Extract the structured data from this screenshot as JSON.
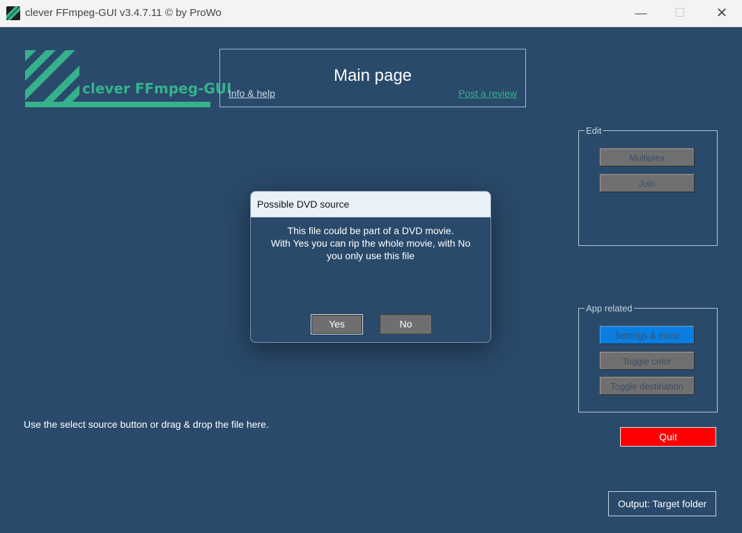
{
  "window": {
    "title": "clever FFmpeg-GUI v3.4.7.11",
    "copyright": "© by ProWo",
    "minimize_icon": "minimize-icon",
    "maximize_icon": "maximize-icon",
    "close_icon": "close-icon"
  },
  "logo": {
    "text": "clever FFmpeg-GUI"
  },
  "header": {
    "title": "Main page",
    "info_link": "Info & help",
    "review_link": "Post a review"
  },
  "edit_group": {
    "legend": "Edit",
    "multiplex_label": "Multiplex",
    "join_label": "Join"
  },
  "app_group": {
    "legend": "App related",
    "settings_label": "Settings & more",
    "toggle_color_label": "Toggle color",
    "toggle_destination_label": "Toggle destination"
  },
  "main": {
    "drop_hint": "Use the select source button or drag & drop the file here.",
    "quit_label": "Quit",
    "output_label": "Output: Target folder"
  },
  "dialog": {
    "title": "Possible DVD source",
    "line1": "This file could be part of a DVD movie.",
    "line2": "With Yes you can rip the whole movie, with No",
    "line3": "you only use this file",
    "yes_label": "Yes",
    "no_label": "No"
  },
  "colors": {
    "background": "#2a4a6b",
    "accent_green": "#35b28c",
    "quit_red": "#ff0000",
    "settings_blue": "#0a7ee0"
  }
}
